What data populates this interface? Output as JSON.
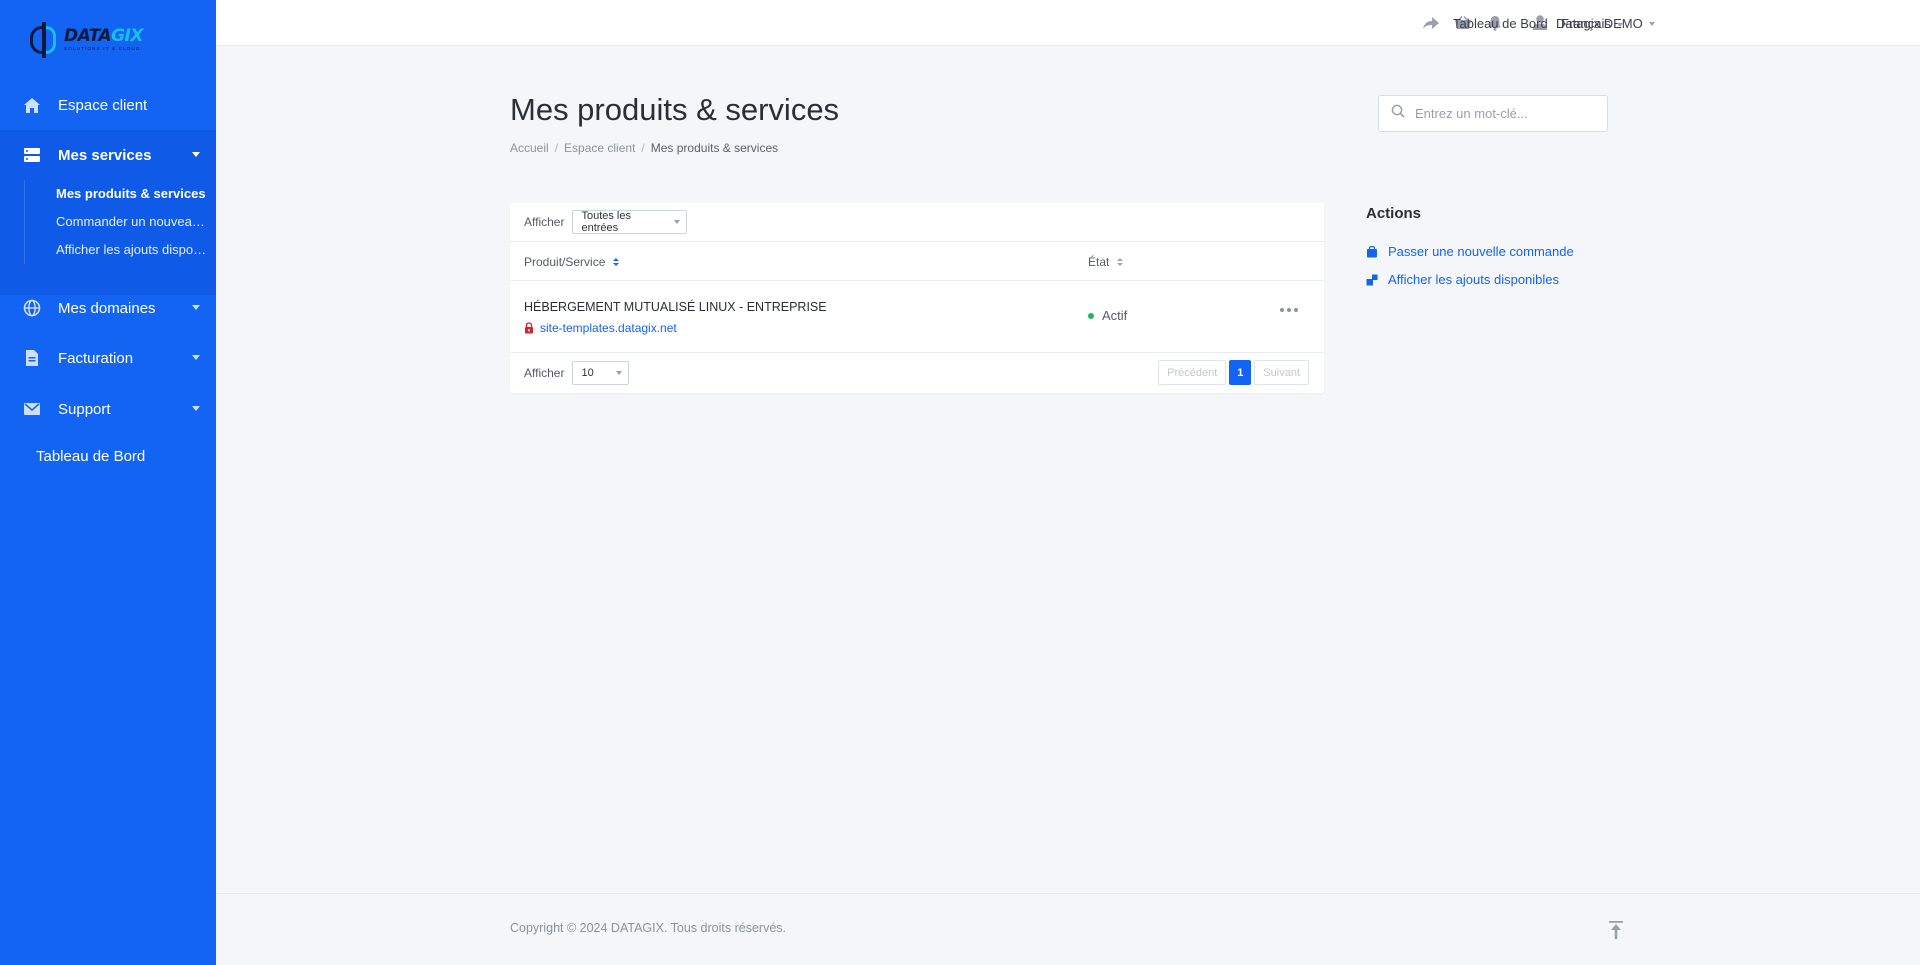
{
  "brand": {
    "logo_word_a": "DATA",
    "logo_word_b": "GIX",
    "logo_tagline": "SOLUTIONS IT & CLOUD",
    "accent": "#1464f4",
    "active_bg": "#0f5ae6"
  },
  "sidebar": {
    "items": [
      {
        "label": "Espace client",
        "icon": "home-icon"
      },
      {
        "label": "Mes services",
        "icon": "server-icon"
      },
      {
        "label": "Mes domaines",
        "icon": "globe-icon"
      },
      {
        "label": "Facturation",
        "icon": "document-icon"
      },
      {
        "label": "Support",
        "icon": "envelope-icon"
      }
    ],
    "services_sub": [
      "Mes produits & services",
      "Commander un nouveau service",
      "Afficher les ajouts disponibles"
    ],
    "dashboard": "Tableau de Bord"
  },
  "header": {
    "user": "Datagix DEMO",
    "dashboard": "Tableau de Bord",
    "language": "Français",
    "icons": [
      "share-icon",
      "basket-icon",
      "bell-icon"
    ]
  },
  "main": {
    "title": "Mes produits & services",
    "breadcrumb": [
      "Accueil",
      "Espace client",
      "Mes produits & services"
    ],
    "search_placeholder": "Entrez un mot-clé..."
  },
  "table": {
    "show_label": "Afficher",
    "filter_value": "Toutes les entrées",
    "columns": [
      "Produit/Service",
      "État"
    ],
    "rows": [
      {
        "product": "HÉBERGEMENT MUTUALISÉ LINUX - ENTREPRISE",
        "domain": "site-templates.datagix.net",
        "status": "Actif",
        "status_color": "#21b35e"
      }
    ],
    "page_size": "10",
    "prev": "Précédent",
    "page": "1",
    "next": "Suivant"
  },
  "actions": {
    "title": "Actions",
    "links": [
      "Passer une nouvelle commande",
      "Afficher les ajouts disponibles"
    ]
  },
  "footer": {
    "copyright": "Copyright © 2024 DATAGIX. Tous droits réservés."
  }
}
